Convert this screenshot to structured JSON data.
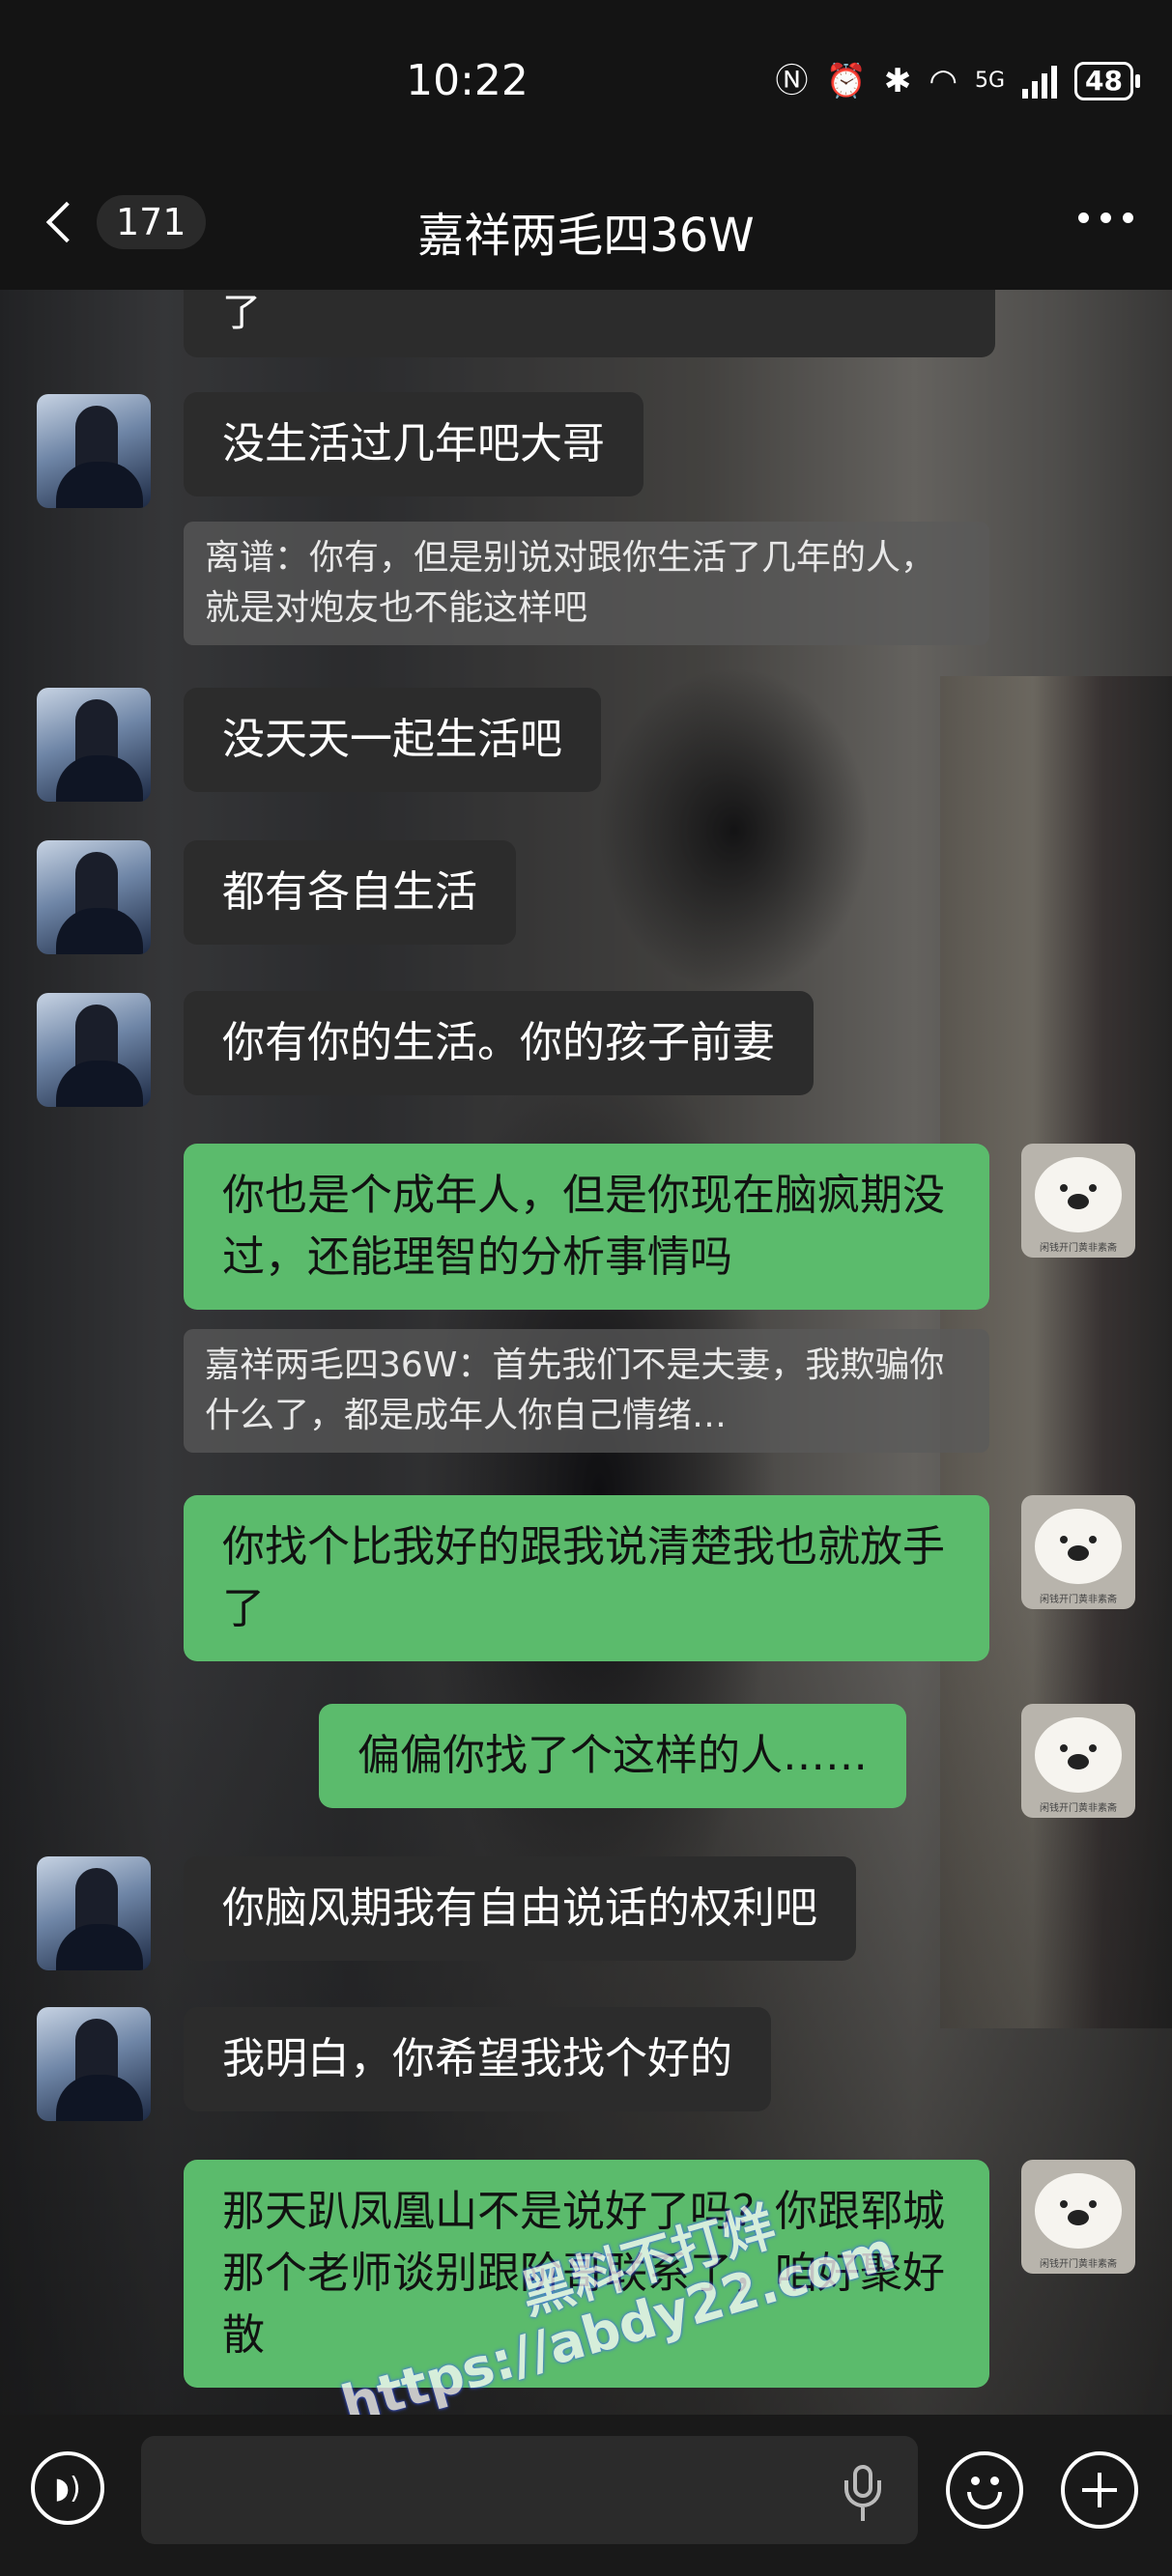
{
  "status_bar": {
    "time": "10:22",
    "network": "5G",
    "battery": "48",
    "icons": [
      "nfc-icon",
      "alarm-icon",
      "bluetooth-icon",
      "wifi-icon",
      "signal-icon",
      "battery-icon"
    ]
  },
  "nav": {
    "unread_count": "171",
    "title": "嘉祥两毛四36W"
  },
  "messages": [
    {
      "side": "left",
      "kind": "partial",
      "text": "了"
    },
    {
      "side": "left",
      "kind": "text",
      "text": "没生活过几年吧大哥"
    },
    {
      "side": "left",
      "kind": "quote",
      "text": "离谱：你有，但是别说对跟你生活了几年的人，就是对炮友也不能这样吧"
    },
    {
      "side": "left",
      "kind": "text",
      "text": "没天天一起生活吧"
    },
    {
      "side": "left",
      "kind": "text",
      "text": "都有各自生活"
    },
    {
      "side": "left",
      "kind": "text",
      "text": "你有你的生活。你的孩子前妻"
    },
    {
      "side": "right",
      "kind": "text",
      "text": "你也是个成年人，但是你现在脑疯期没过，还能理智的分析事情吗"
    },
    {
      "side": "right",
      "kind": "quote",
      "text": "嘉祥两毛四36W：首先我们不是夫妻，我欺骗你什么了，都是成年人你自己情绪…"
    },
    {
      "side": "right",
      "kind": "text",
      "text": "你找个比我好的跟我说清楚我也就放手了"
    },
    {
      "side": "right",
      "kind": "text",
      "text": "偏偏你找了个这样的人……"
    },
    {
      "side": "left",
      "kind": "text",
      "text": "你脑风期我有自由说话的权利吧"
    },
    {
      "side": "left",
      "kind": "text",
      "text": "我明白，你希望我找个好的"
    },
    {
      "side": "right",
      "kind": "text",
      "text": "那天趴凤凰山不是说好了吗？你跟郓城那个老师谈别跟阶哥联系了，咱好聚好散"
    }
  ],
  "watermark": {
    "line1": "黑料不打烊",
    "line2": "https://abdy22.com"
  },
  "input_bar": {
    "placeholder": ""
  },
  "colors": {
    "outgoing_bubble": "#5bbb6c",
    "incoming_bubble": "#2c2c2c",
    "quote_bg": "#5a5a5a"
  }
}
